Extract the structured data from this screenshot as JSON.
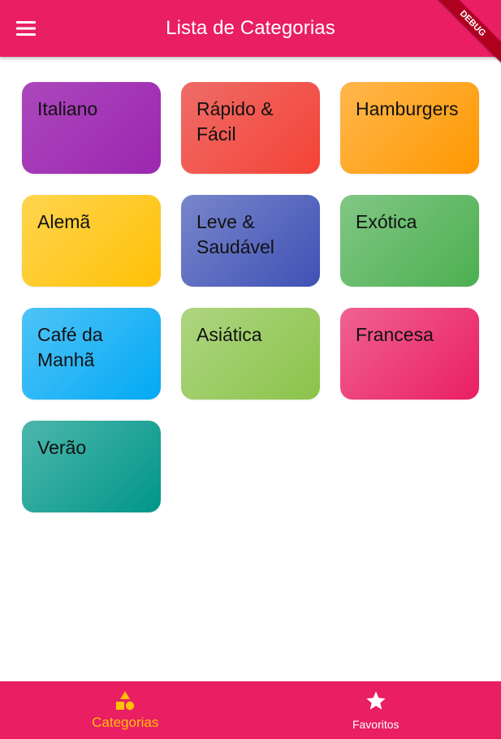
{
  "appbar": {
    "title": "Lista de Categorias",
    "menu_icon": "menu-icon",
    "color": "#e91e63"
  },
  "debug_banner": {
    "label": "DEBUG"
  },
  "categories": [
    {
      "label": "Italiano",
      "color_start": "#ab47bc",
      "color_end": "#9c27b0"
    },
    {
      "label": "Rápido & Fácil",
      "color_start": "#ef6c68",
      "color_end": "#f44336"
    },
    {
      "label": "Hamburgers",
      "color_start": "#ffb74d",
      "color_end": "#ff9800"
    },
    {
      "label": "Alemã",
      "color_start": "#ffd54f",
      "color_end": "#ffc107"
    },
    {
      "label": "Leve & Saudável",
      "color_start": "#7986cb",
      "color_end": "#3f51b5"
    },
    {
      "label": "Exótica",
      "color_start": "#81c784",
      "color_end": "#4caf50"
    },
    {
      "label": "Café da Manhã",
      "color_start": "#4fc3f7",
      "color_end": "#03a9f4"
    },
    {
      "label": "Asiática",
      "color_start": "#aed581",
      "color_end": "#8bc34a"
    },
    {
      "label": "Francesa",
      "color_start": "#f06292",
      "color_end": "#e91e63"
    },
    {
      "label": "Verão",
      "color_start": "#4db6ac",
      "color_end": "#009688"
    }
  ],
  "bottom_nav": {
    "items": [
      {
        "label": "Categorias",
        "icon": "category-icon",
        "active": true
      },
      {
        "label": "Favoritos",
        "icon": "star-icon",
        "active": false
      }
    ],
    "active_color": "#ffc107",
    "inactive_color": "#ffffff"
  }
}
